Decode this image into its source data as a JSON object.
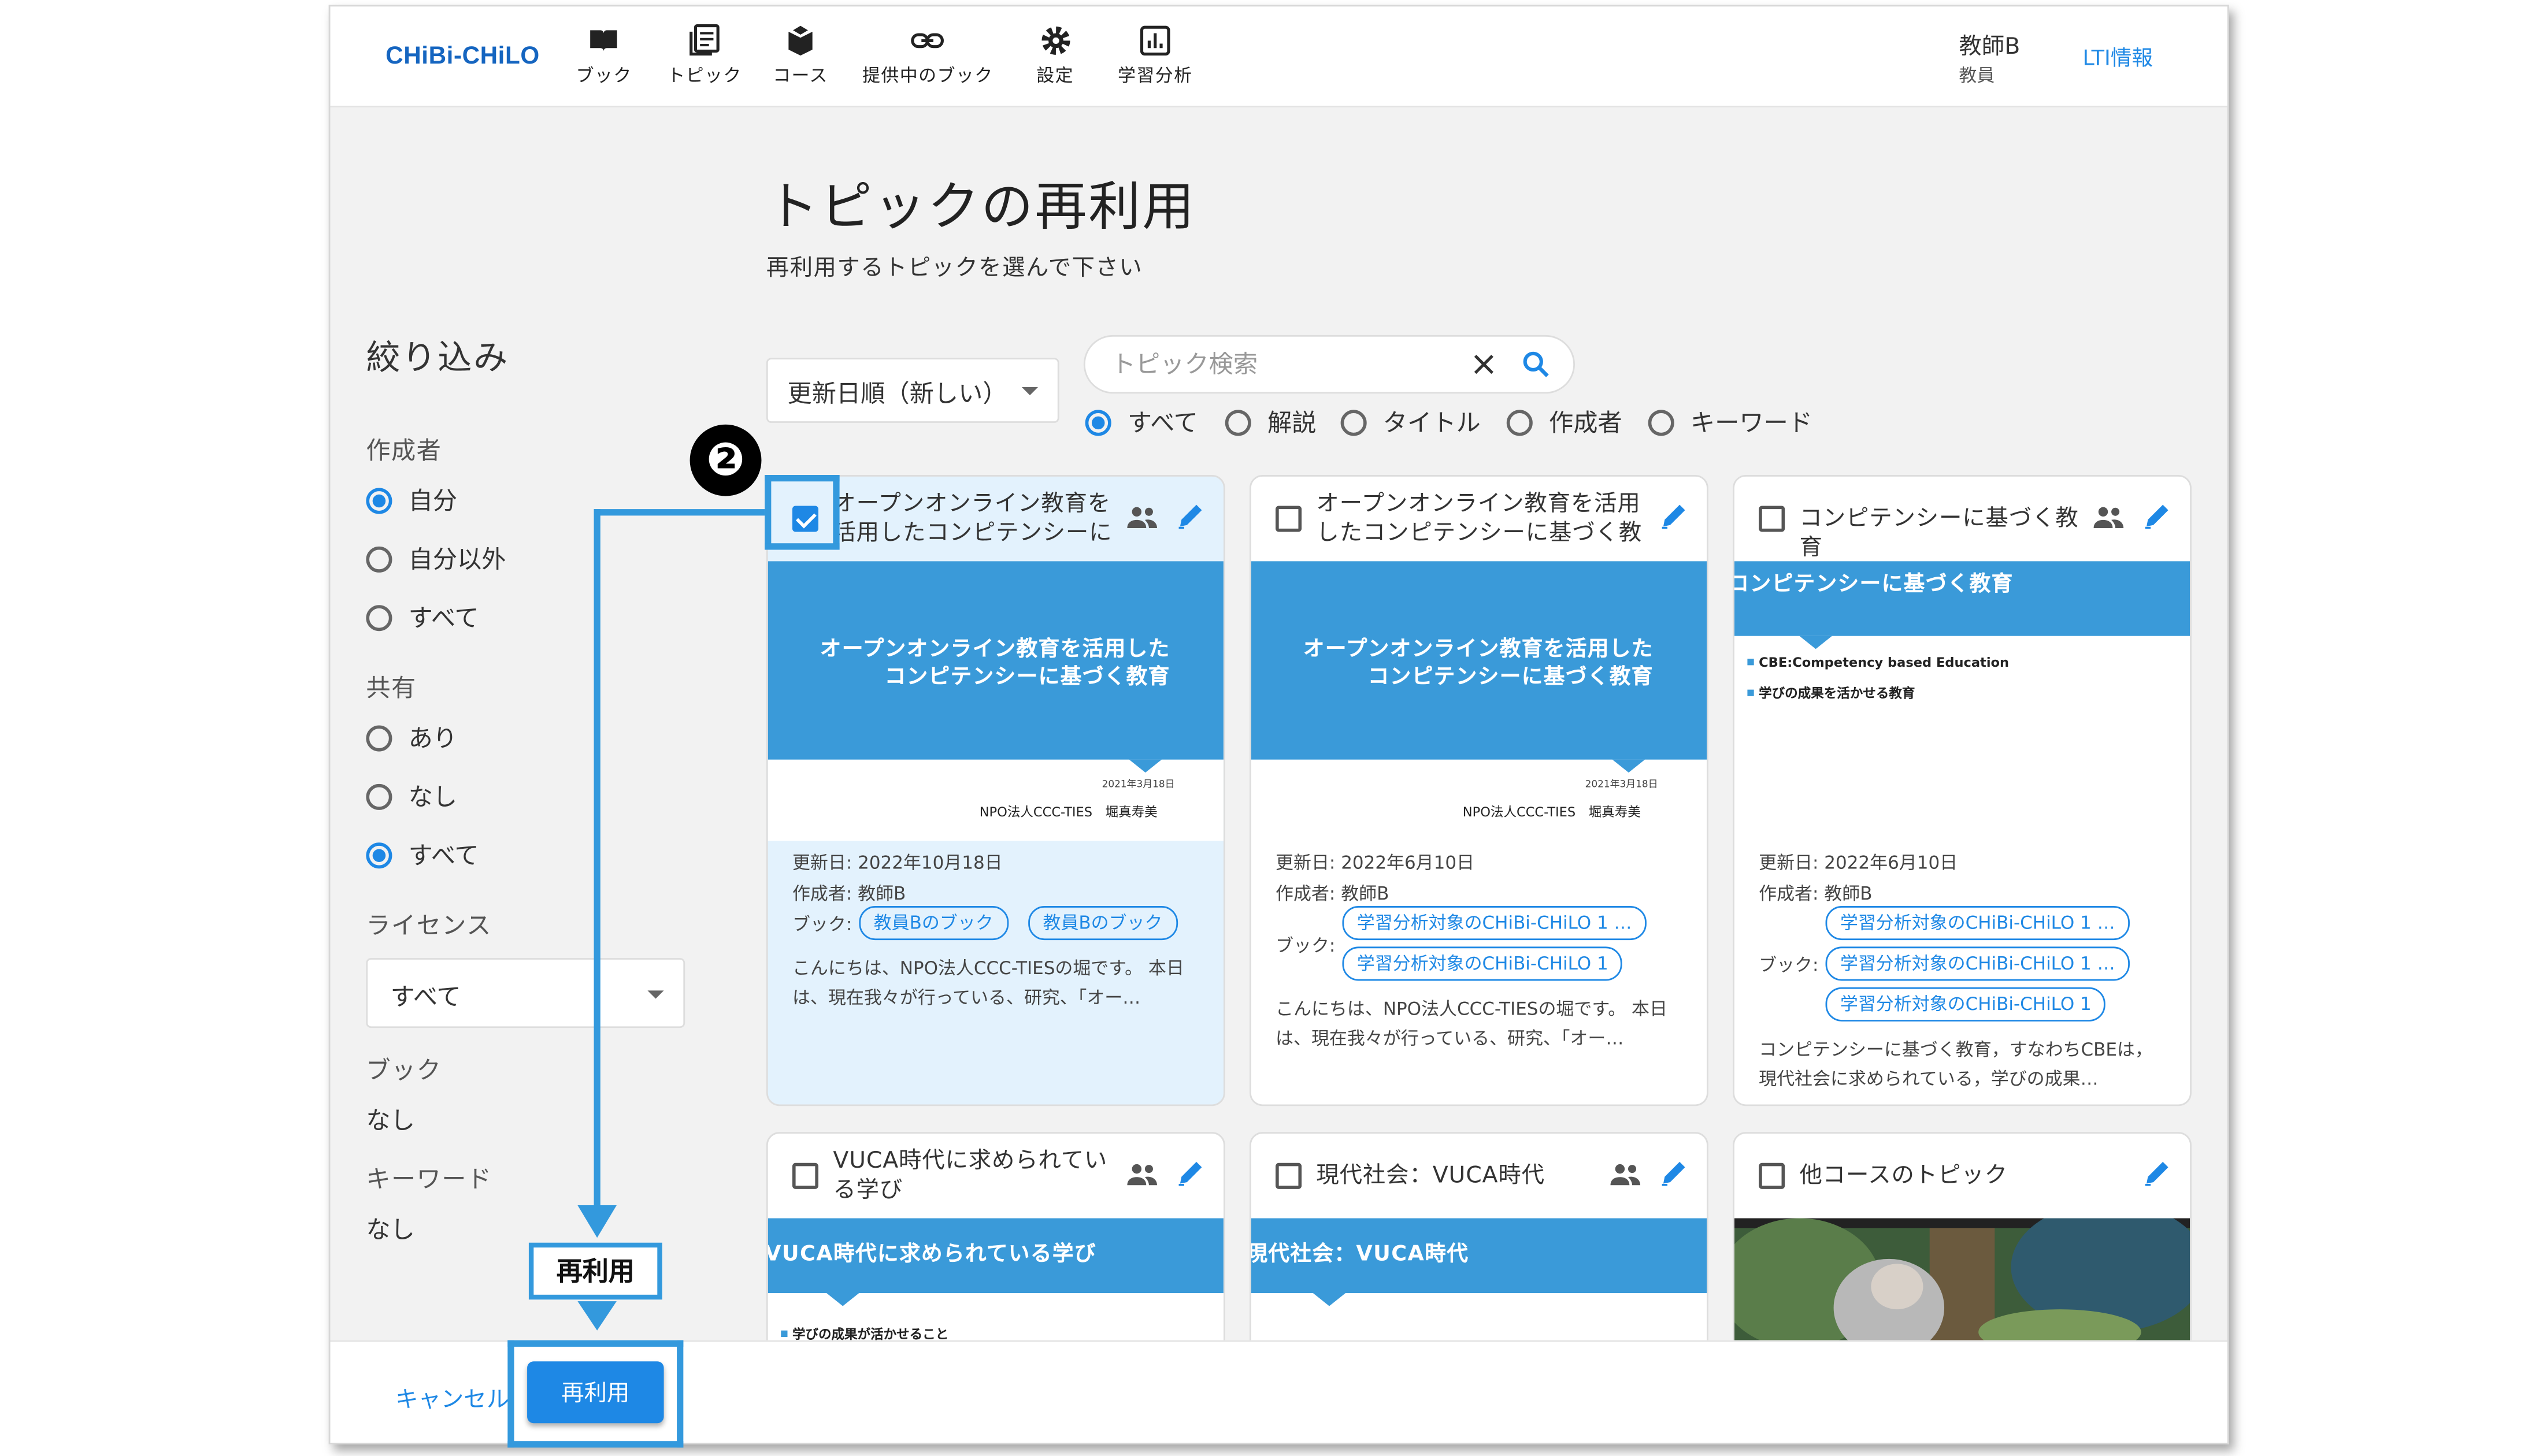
{
  "app": {
    "logo": "CHiBi-CHiLO"
  },
  "nav": [
    {
      "label": "ブック",
      "icon": "book-icon"
    },
    {
      "label": "トピック",
      "icon": "topic-icon"
    },
    {
      "label": "コース",
      "icon": "course-icon"
    },
    {
      "label": "提供中のブック",
      "icon": "link-icon"
    },
    {
      "label": "設定",
      "icon": "gear-icon"
    },
    {
      "label": "学習分析",
      "icon": "analytics-icon"
    }
  ],
  "user": {
    "name": "教師B",
    "role": "教員",
    "lti_link": "LTI情報"
  },
  "page": {
    "title": "トピックの再利用",
    "subtitle": "再利用するトピックを選んで下さい"
  },
  "filter": {
    "title": "絞り込み",
    "author": {
      "label": "作成者",
      "options": [
        "自分",
        "自分以外",
        "すべて"
      ],
      "selected": "自分"
    },
    "shared": {
      "label": "共有",
      "options": [
        "あり",
        "なし",
        "すべて"
      ],
      "selected": "すべて"
    },
    "license": {
      "label": "ライセンス",
      "value": "すべて"
    },
    "book": {
      "label": "ブック",
      "value": "なし"
    },
    "keyword": {
      "label": "キーワード",
      "value": "なし"
    }
  },
  "sort": {
    "value": "更新日順（新しい）"
  },
  "search": {
    "placeholder": "トピック検索",
    "scope_options": [
      "すべて",
      "解説",
      "タイトル",
      "作成者",
      "キーワード"
    ],
    "scope_selected": "すべて"
  },
  "cards": [
    {
      "title": "オープンオンライン教育を活用したコンピテンシーに基…",
      "checked": true,
      "shared": true,
      "slide": {
        "heading": "オープンオンライン教育を活用した\nコンピテンシーに基づく教育",
        "date": "2021年3月18日",
        "org": "NPO法人CCC-TIES　堀真寿美"
      },
      "updated": "更新日: 2022年10月18日",
      "author": "作成者: 教師B",
      "book_label": "ブック:",
      "books": [
        "教員Bのブック",
        "教員Bのブック"
      ],
      "desc": "こんにちは、NPO法人CCC-TIESの堀です。 本日は、現在我々が行っている、研究、「オー…"
    },
    {
      "title": "オープンオンライン教育を活用したコンピテンシーに基づく教育",
      "checked": false,
      "shared": false,
      "slide": {
        "heading": "オープンオンライン教育を活用した\nコンピテンシーに基づく教育",
        "date": "2021年3月18日",
        "org": "NPO法人CCC-TIES　堀真寿美"
      },
      "updated": "更新日: 2022年6月10日",
      "author": "作成者: 教師B",
      "book_label": "ブック:",
      "books": [
        "学習分析対象のCHiBi-CHiLO 1 …",
        "学習分析対象のCHiBi-CHiLO 1"
      ],
      "desc": "こんにちは、NPO法人CCC-TIESの堀です。 本日は、現在我々が行っている、研究、「オー…"
    },
    {
      "title": "コンピテンシーに基づく教育",
      "checked": false,
      "shared": true,
      "slide": {
        "heading": "コンピテンシーに基づく教育",
        "bullets": [
          "CBE:Competency based Education",
          "学びの成果を活かせる教育"
        ]
      },
      "updated": "更新日: 2022年6月10日",
      "author": "作成者: 教師B",
      "book_label": "ブック:",
      "books": [
        "学習分析対象のCHiBi-CHiLO 1 …",
        "学習分析対象のCHiBi-CHiLO 1 …",
        "学習分析対象のCHiBi-CHiLO 1"
      ],
      "desc": "コンピテンシーに基づく教育，すなわちCBEは，現代社会に求められている，学びの成果…"
    },
    {
      "title": "VUCA時代に求められている学び",
      "checked": false,
      "shared": true,
      "slide": {
        "heading": "VUCA時代に求められている学び",
        "bullets": [
          "学びの成果が活かせること"
        ]
      }
    },
    {
      "title": "現代社会：VUCA時代",
      "checked": false,
      "shared": true,
      "slide": {
        "heading": "現代社会：VUCA時代"
      }
    },
    {
      "title": "他コースのトピック",
      "checked": false,
      "shared": false,
      "slide": {
        "video": true
      }
    }
  ],
  "footer": {
    "cancel": "キャンセル",
    "reuse": "再利用"
  },
  "annotation": {
    "step": "❷",
    "callout": "再利用"
  },
  "colors": {
    "accent": "#1e88e5",
    "slide_band": "#3a9ad9",
    "annotation": "#3399dd"
  }
}
